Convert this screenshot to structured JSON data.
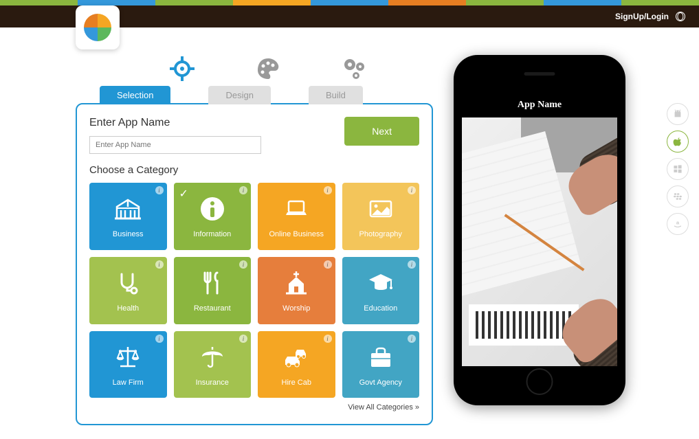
{
  "topstrip_colors": [
    "#8bb63f",
    "#3498db",
    "#8bb63f",
    "#f5a623",
    "#3498db",
    "#e67e22",
    "#8bb63f",
    "#3498db",
    "#8bb63f"
  ],
  "nav": {
    "auth": "SignUp/Login"
  },
  "steps": [
    {
      "name": "selection",
      "label": "Selection",
      "active": true
    },
    {
      "name": "design",
      "label": "Design",
      "active": false
    },
    {
      "name": "build",
      "label": "Build",
      "active": false
    }
  ],
  "form": {
    "title": "Enter App Name",
    "placeholder": "Enter App Name",
    "next": "Next",
    "choose": "Choose a Category"
  },
  "categories": [
    {
      "label": "Business",
      "color": "#2196d4",
      "icon": "building"
    },
    {
      "label": "Information",
      "color": "#8bb63f",
      "icon": "info",
      "selected": true
    },
    {
      "label": "Online Business",
      "color": "#f5a623",
      "icon": "laptop"
    },
    {
      "label": "Photography",
      "color": "#f3c55a",
      "icon": "photo"
    },
    {
      "label": "Health",
      "color": "#a3c24f",
      "icon": "stethoscope"
    },
    {
      "label": "Restaurant",
      "color": "#8bb63f",
      "icon": "utensils"
    },
    {
      "label": "Worship",
      "color": "#e67e3c",
      "icon": "church"
    },
    {
      "label": "Education",
      "color": "#42a5c4",
      "icon": "gradcap"
    },
    {
      "label": "Law Firm",
      "color": "#2196d4",
      "icon": "scales"
    },
    {
      "label": "Insurance",
      "color": "#a3c24f",
      "icon": "umbrella"
    },
    {
      "label": "Hire Cab",
      "color": "#f5a623",
      "icon": "cars"
    },
    {
      "label": "Govt Agency",
      "color": "#42a5c4",
      "icon": "briefcase"
    }
  ],
  "viewall": "View All Categories ",
  "phone": {
    "title": "App Name"
  },
  "platforms": [
    {
      "name": "android",
      "active": false
    },
    {
      "name": "apple",
      "active": true
    },
    {
      "name": "windows",
      "active": false
    },
    {
      "name": "blackberry",
      "active": false
    },
    {
      "name": "amazon",
      "active": false
    }
  ]
}
